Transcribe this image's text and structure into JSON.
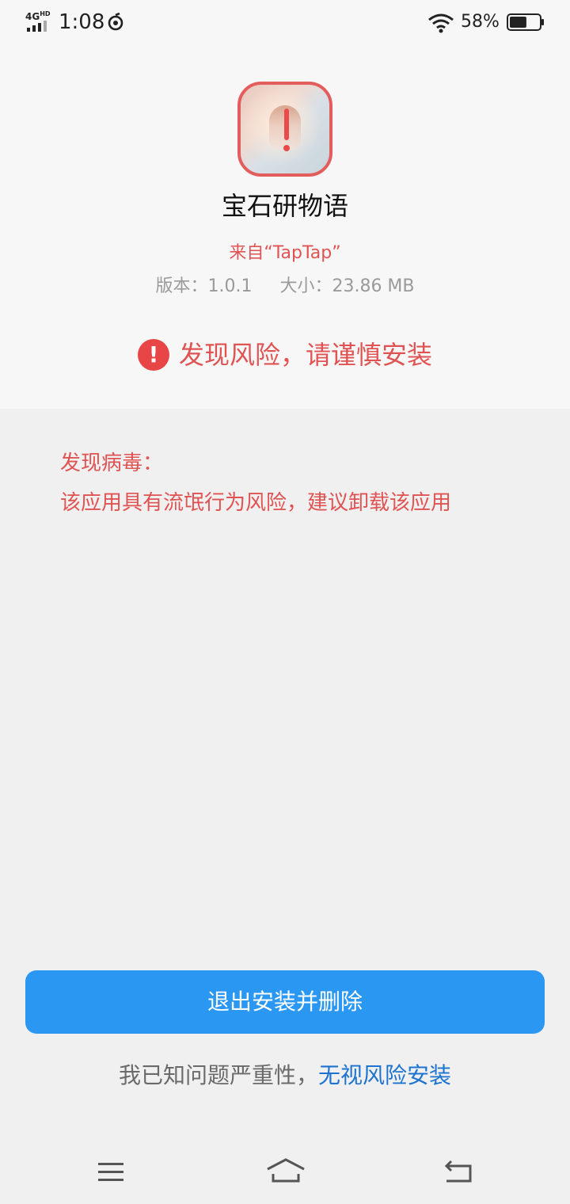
{
  "status_bar": {
    "network": "4G",
    "network_sup": "HD",
    "time": "1:08",
    "battery_percent": "58%",
    "battery_level": 0.58,
    "icons": [
      "signal-icon",
      "sync-icon",
      "wifi-icon",
      "battery-icon"
    ]
  },
  "app": {
    "name": "宝石研物语",
    "source": "来自“TapTap”",
    "version": "版本：1.0.1",
    "size": "大小：23.86 MB"
  },
  "risk": {
    "icon_glyph": "!",
    "heading": "发现风险，请谨慎安装",
    "virus_title": "发现病毒：",
    "virus_desc": "该应用具有流氓行为风险，建议卸载该应用"
  },
  "actions": {
    "primary_label": "退出安装并删除",
    "ignore_prefix": "我已知问题严重性，",
    "ignore_link": "无视风险安装"
  },
  "navbar": {
    "icons": [
      "menu-icon",
      "home-icon",
      "back-icon"
    ]
  },
  "colors": {
    "danger": "#e05353",
    "primary": "#2a97f2",
    "link": "#1d73cf"
  }
}
